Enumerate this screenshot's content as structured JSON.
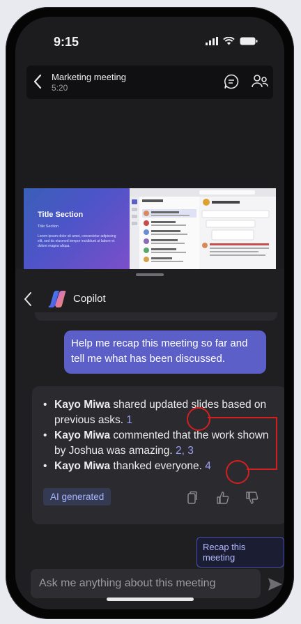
{
  "status": {
    "time": "9:15"
  },
  "meeting": {
    "title": "Marketing meeting",
    "elapsed": "5:20"
  },
  "slide": {
    "title": "Title Section",
    "subtitle": "Title Section",
    "body": "Lorem ipsum dolor sit amet, consectetur adipiscing elit, sed do eiusmod tempor incididunt ut labore et dolore magna aliqua."
  },
  "copilot": {
    "title": "Copilot",
    "user_prompt": "Help me recap this meeting so far and tell me what has been discussed.",
    "response": [
      {
        "name": "Kayo Miwa",
        "text": " shared updated slides based on previous asks. ",
        "cite": "1"
      },
      {
        "name": "Kayo Miwa",
        "text": " commented that the work shown by Joshua was amazing. ",
        "cite": "2, 3"
      },
      {
        "name": "Kayo Miwa",
        "text": " thanked everyone. ",
        "cite": "4"
      }
    ],
    "ai_label": "AI generated",
    "suggestion": "Recap this meeting",
    "input_placeholder": "Ask me anything about this meeting"
  },
  "colors": {
    "accent": "#5b5fc7",
    "citation": "#9b9ff5",
    "annotation": "#d21f1f"
  }
}
